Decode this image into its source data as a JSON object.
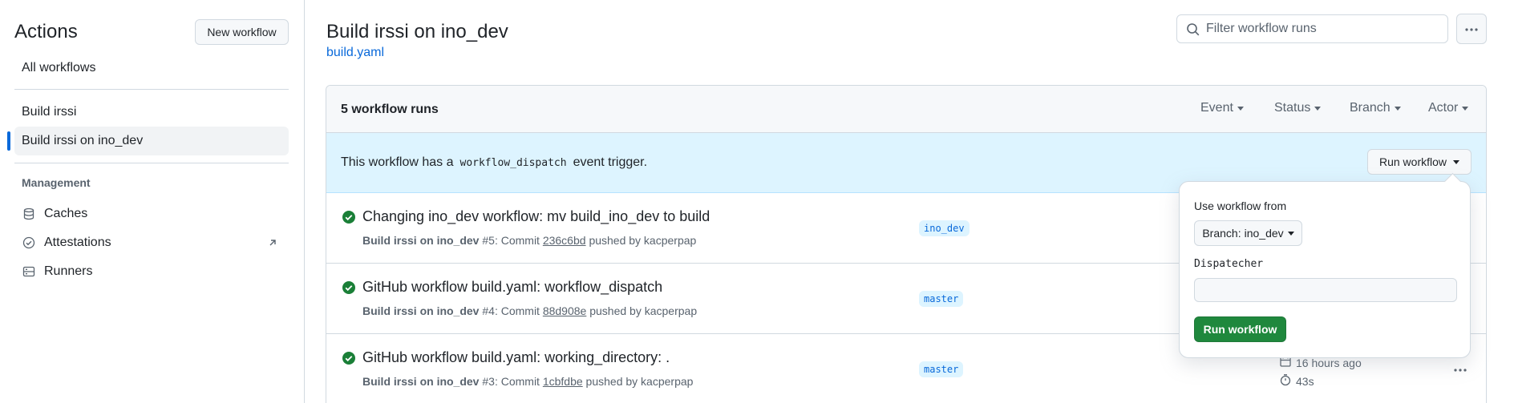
{
  "sidebar": {
    "title": "Actions",
    "new_workflow_label": "New workflow",
    "all_workflows": "All workflows",
    "workflows": [
      {
        "label": "Build irssi"
      },
      {
        "label": "Build irssi on ino_dev"
      }
    ],
    "management_heading": "Management",
    "management_items": [
      {
        "label": "Caches",
        "icon": "cache-icon"
      },
      {
        "label": "Attestations",
        "icon": "attestation-icon"
      },
      {
        "label": "Runners",
        "icon": "runners-icon"
      }
    ]
  },
  "header": {
    "title": "Build irssi on ino_dev",
    "file_link": "build.yaml",
    "filter_placeholder": "Filter workflow runs"
  },
  "runs": {
    "count_label": "5 workflow runs",
    "filters": [
      "Event",
      "Status",
      "Branch",
      "Actor"
    ],
    "dispatch_before": "This workflow has a",
    "dispatch_code": "workflow_dispatch",
    "dispatch_after": "event trigger.",
    "run_workflow_label": "Run workflow",
    "items": [
      {
        "title": "Changing ino_dev workflow: mv build_ino_dev to build",
        "workflow": "Build irssi on ino_dev",
        "number": "#5",
        "commit_prefix": ": Commit",
        "sha": "236c6bd",
        "pushed_by": "pushed by kacperpap",
        "branch": "ino_dev",
        "status": "success"
      },
      {
        "title": "GitHub workflow build.yaml: workflow_dispatch",
        "workflow": "Build irssi on ino_dev",
        "number": "#4",
        "commit_prefix": ": Commit",
        "sha": "88d908e",
        "pushed_by": "pushed by kacperpap",
        "branch": "master",
        "status": "success"
      },
      {
        "title": "GitHub workflow build.yaml: working_directory: .",
        "workflow": "Build irssi on ino_dev",
        "number": "#3",
        "commit_prefix": ": Commit",
        "sha": "1cbfdbe",
        "pushed_by": "pushed by kacperpap",
        "branch": "master",
        "status": "success",
        "time_ago": "16 hours ago",
        "duration": "43s"
      }
    ]
  },
  "popover": {
    "use_from_label": "Use workflow from",
    "branch_prefix": "Branch:",
    "branch_value": "ino_dev",
    "input_label": "Dispatecher",
    "input_value": "",
    "submit_label": "Run workflow"
  },
  "colors": {
    "accent": "#0969da",
    "success": "#1a7f37",
    "primary_button": "#1f883d",
    "banner": "#ddf4ff"
  }
}
